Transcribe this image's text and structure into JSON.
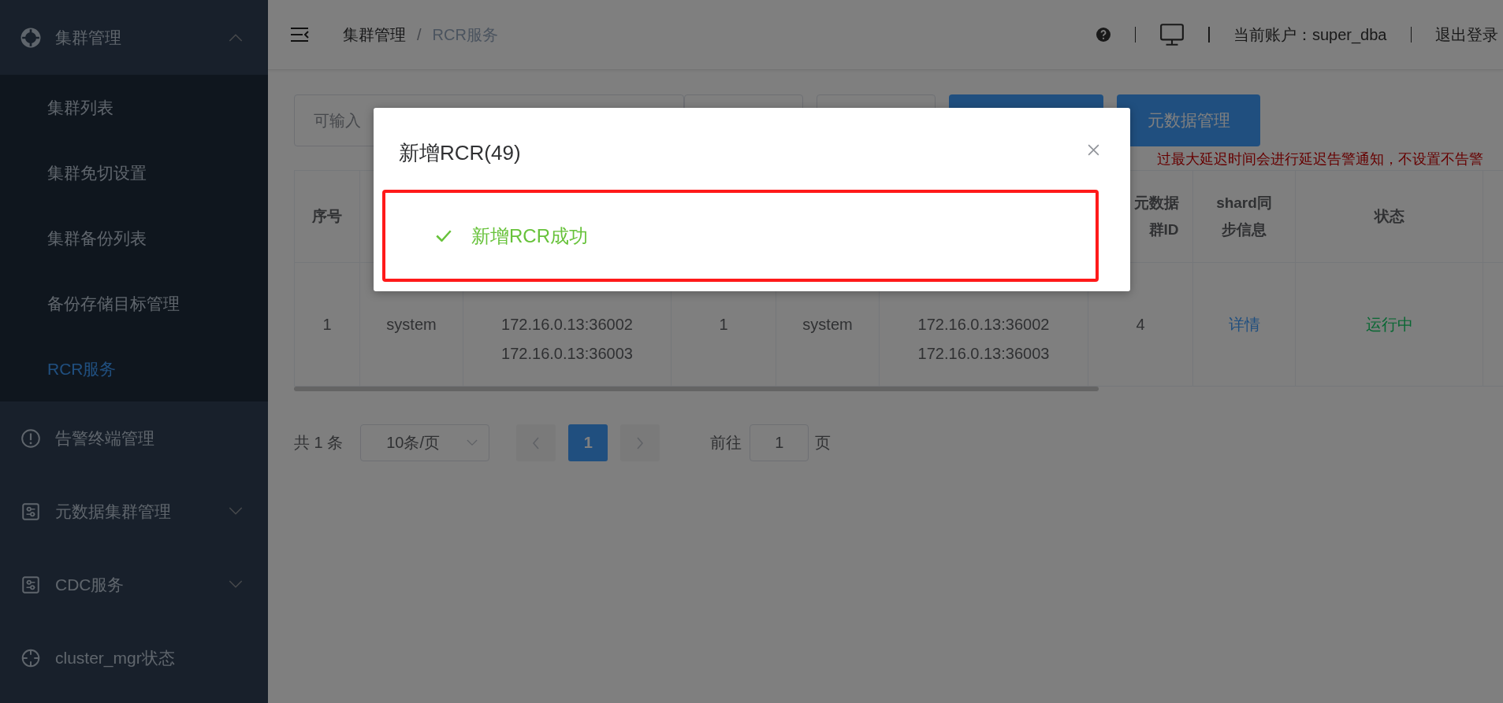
{
  "sidebar": {
    "items": [
      {
        "label": "集群管理",
        "expanded": true,
        "children": [
          {
            "label": "集群列表",
            "selected": false
          },
          {
            "label": "集群免切设置",
            "selected": false
          },
          {
            "label": "集群备份列表",
            "selected": false
          },
          {
            "label": "备份存储目标管理",
            "selected": false
          },
          {
            "label": "RCR服务",
            "selected": true
          }
        ]
      },
      {
        "label": "告警终端管理"
      },
      {
        "label": "元数据集群管理",
        "expanded": false
      },
      {
        "label": "CDC服务",
        "expanded": false
      },
      {
        "label": "cluster_mgr状态"
      }
    ]
  },
  "header": {
    "breadcrumb": [
      "集群管理",
      "RCR服务"
    ],
    "separator": "/",
    "account": "当前账户：super_dba",
    "logout": "退出登录"
  },
  "toolbar": {
    "search": {
      "placeholder": "可输入"
    },
    "meta_button": "元数据管理",
    "warning": "过最大延迟时间会进行延迟告警通知，不设置不告警"
  },
  "table": {
    "columns": [
      {
        "lines": [
          "序号"
        ]
      },
      {},
      {},
      {},
      {},
      {},
      {
        "lines": [
          "元数据",
          "群ID"
        ]
      },
      {
        "lines": [
          "shard同",
          "步信息"
        ]
      },
      {
        "lines": [
          "状态"
        ]
      },
      {}
    ],
    "rows": [
      {
        "cells": [
          {
            "kind": "text",
            "lines": [
              "1"
            ]
          },
          {
            "kind": "text",
            "lines": [
              "system"
            ]
          },
          {
            "kind": "list",
            "lines": [
              "172.16.0.13:36002",
              "172.16.0.13:36003"
            ]
          },
          {
            "kind": "text",
            "lines": [
              "1"
            ]
          },
          {
            "kind": "text",
            "lines": [
              "system"
            ]
          },
          {
            "kind": "list",
            "lines": [
              "172.16.0.13:36002",
              "172.16.0.13:36003"
            ]
          },
          {
            "kind": "text",
            "lines": [
              "4"
            ]
          },
          {
            "kind": "link",
            "lines": [
              "详情"
            ]
          },
          {
            "kind": "status",
            "lines": [
              "运行中"
            ]
          }
        ]
      }
    ]
  },
  "pagination": {
    "total": "共 1 条",
    "page_size": "10条/页",
    "pages": [
      {
        "label": "1",
        "selected": true
      }
    ],
    "goto_label": "前往",
    "goto_value": "1",
    "page_unit": "页"
  },
  "modal": {
    "title": "新增RCR(49)",
    "message": "新增RCR成功",
    "highlighted": true
  }
}
